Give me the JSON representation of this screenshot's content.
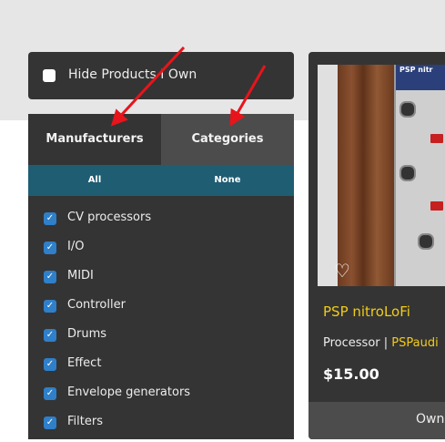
{
  "hide_products": {
    "label": "Hide Products I Own",
    "checked": false
  },
  "tabs": [
    {
      "label": "Manufacturers",
      "active": true
    },
    {
      "label": "Categories",
      "active": false
    }
  ],
  "select_bar": {
    "all_label": "All",
    "none_label": "None"
  },
  "categories": [
    {
      "label": "CV processors",
      "checked": true
    },
    {
      "label": "I/O",
      "checked": true
    },
    {
      "label": "MIDI",
      "checked": true
    },
    {
      "label": "Controller",
      "checked": true
    },
    {
      "label": "Drums",
      "checked": true
    },
    {
      "label": "Effect",
      "checked": true
    },
    {
      "label": "Envelope generators",
      "checked": true
    },
    {
      "label": "Filters",
      "checked": true
    }
  ],
  "product_card": {
    "title": "PSP nitroLoFi",
    "type": "Processor",
    "separator": " | ",
    "manufacturer": "PSPaudi",
    "price": "$15.00",
    "button_label": "Own",
    "image_header": "PSP nitr",
    "favorited": false
  },
  "colors": {
    "accent_yellow": "#f2cc16",
    "select_bar": "#1f5d73",
    "panel": "#343434",
    "checkbox": "#2f7fc9",
    "arrow": "#e8141b"
  },
  "icons": [
    "heart-icon",
    "check-icon",
    "arrow-annotation"
  ]
}
